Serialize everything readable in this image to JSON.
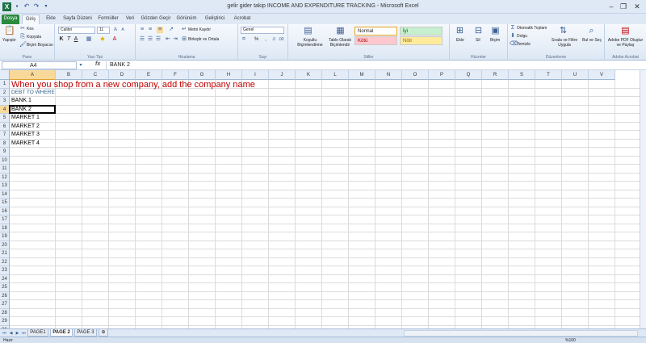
{
  "window": {
    "title": "gelir gider takip INCOME AND EXPENDITURE TRACKING  -  Microsoft Excel",
    "minimize": "–",
    "restore": "❐",
    "close": "✕",
    "help": "?"
  },
  "tabs": [
    "Dosya",
    "Giriş",
    "Ekle",
    "Sayfa Düzeni",
    "Formüller",
    "Veri",
    "Gözden Geçir",
    "Görünüm",
    "Geliştirici",
    "Acrobat"
  ],
  "ribbon": {
    "clipboard": {
      "paste": "Yapıştır",
      "cut": "Kes",
      "copy": "Kopyala",
      "format_painter": "Biçim Boyacısı",
      "label": "Pano"
    },
    "font": {
      "name": "Calibri",
      "size": "11",
      "label": "Yazı Tipi"
    },
    "alignment": {
      "wrap": "Metni Kaydır",
      "merge": "Birleştir ve Ortala",
      "label": "Hizalama"
    },
    "number": {
      "format": "Genel",
      "percent": "%",
      "label": "Sayı"
    },
    "styles": {
      "conditional": "Koşullu Biçimlendirme",
      "table": "Tablo Olarak Biçimlendir",
      "normal": "Normal",
      "good": "İyi",
      "bad": "Kötü",
      "neutral": "Nötr",
      "label": "Stiller"
    },
    "cells": {
      "insert": "Ekle",
      "delete": "Sil",
      "format": "Biçim",
      "label": "Hücreler"
    },
    "editing": {
      "autosum": "Otomatik Toplam",
      "fill": "Dolgu",
      "clear": "Temizle",
      "sort": "Sırala ve Filtre Uygula",
      "find": "Bul ve Seç",
      "label": "Düzenleme"
    },
    "acrobat": {
      "create_pdf": "Adobe PDF Oluştur ve Paylaş",
      "label": "Adobe Acrobat"
    }
  },
  "formula_bar": {
    "name_box": "A4",
    "fx": "fx",
    "content": "BANK 2"
  },
  "grid": {
    "columns": [
      "A",
      "B",
      "C",
      "D",
      "E",
      "F",
      "G",
      "H",
      "I",
      "J",
      "K",
      "L",
      "M",
      "N",
      "O",
      "P",
      "Q",
      "R",
      "S",
      "T",
      "U",
      "V"
    ],
    "rows": [
      "1",
      "2",
      "3",
      "4",
      "5",
      "6",
      "7",
      "8",
      "9",
      "10",
      "11",
      "12",
      "13",
      "14",
      "15",
      "16",
      "17",
      "18",
      "19",
      "20",
      "21",
      "22",
      "23",
      "24",
      "25",
      "26",
      "27",
      "28",
      "29",
      "30",
      "31",
      "32",
      "33"
    ],
    "selected_col": "A",
    "selected_row": "4",
    "cells": {
      "A1": "When you shop from a new company, add the company name",
      "A2": "DEBT TO WHERE",
      "A3": "BANK 1",
      "A4": "BANK 2",
      "A5": "MARKET 1",
      "A6": "MARKET 2",
      "A7": "MARKET 3",
      "A8": "MARKET 4"
    },
    "colors": {
      "title_text": "#c00000",
      "header_text": "#2e5c8a"
    }
  },
  "sheets": {
    "tabs": [
      "PAGE1",
      "PAGE 2",
      "PAGE 3"
    ],
    "active": "PAGE 2"
  },
  "status": {
    "ready": "Hazır",
    "zoom": "%100"
  }
}
